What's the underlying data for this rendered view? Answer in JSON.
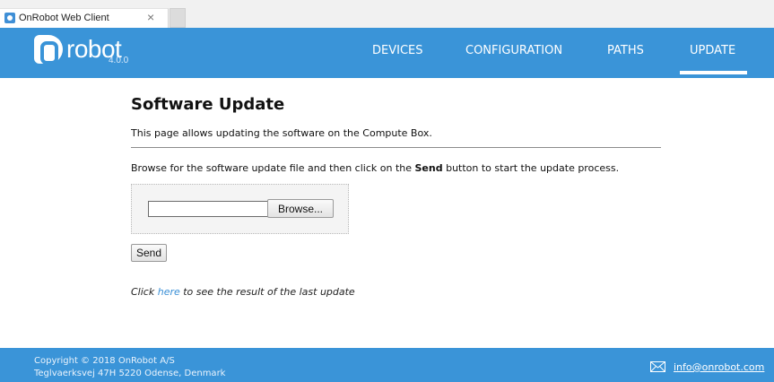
{
  "browser": {
    "tab_title": "OnRobot Web Client",
    "tab_close": "×"
  },
  "header": {
    "logo_text": "robot",
    "version": "4.0.0",
    "nav": {
      "devices": "DEVICES",
      "configuration": "CONFIGURATION",
      "paths": "PATHS",
      "update": "UPDATE"
    },
    "active_nav": "UPDATE"
  },
  "main": {
    "title": "Software Update",
    "intro": "This page allows updating the software on the Compute Box.",
    "instruction_pre": "Browse for the software update file and then click on the ",
    "instruction_bold": "Send",
    "instruction_post": " button to start the update process.",
    "file_value": "",
    "browse_label": "Browse...",
    "send_label": "Send",
    "result_pre": "Click ",
    "result_link": "here",
    "result_post": " to see the result of the last update"
  },
  "footer": {
    "copyright": "Copyright © 2018 OnRobot A/S",
    "address": "Teglvaerksvej 47H 5220 Odense, Denmark",
    "email": "info@onrobot.com",
    "icon": "mail-icon"
  },
  "colors": {
    "brand_blue": "#3a94d8",
    "link_blue": "#3a8fd6"
  }
}
